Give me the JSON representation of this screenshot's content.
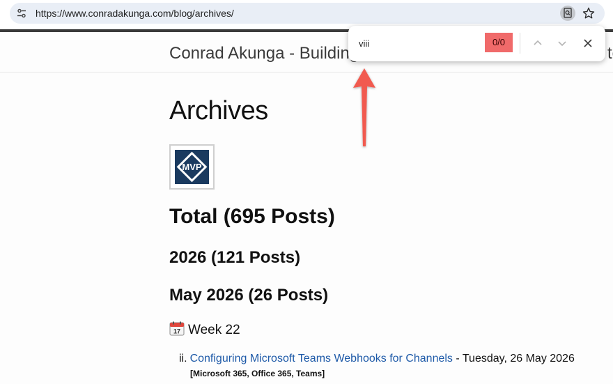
{
  "browser": {
    "url": "https://www.conradakunga.com/blog/archives/",
    "icons": {
      "site_settings": "tune-icon",
      "find": "find-in-page-icon",
      "bookmark": "star-icon"
    }
  },
  "find_bar": {
    "query": "viii",
    "match_count": "0/0",
    "no_match_color": "#f06a6a",
    "icons": {
      "previous": "chevron-up-icon",
      "next": "chevron-down-icon",
      "close": "close-icon"
    }
  },
  "site": {
    "title": "Conrad Akunga - Building",
    "title_tail": "te"
  },
  "content": {
    "page_title": "Archives",
    "badge_text": "MVP",
    "total_heading": "Total (695 Posts)",
    "year_heading": "2026 (121 Posts)",
    "month_heading": "May 2026 (26 Posts)",
    "week_heading": "Week 22",
    "week_icon": "calendar-icon",
    "posts": [
      {
        "numeral": "ii.",
        "title": "Configuring Microsoft Teams Webhooks for Channels",
        "date_text": " - Tuesday, 26 May 2026",
        "tags": "[Microsoft 365, Office 365, Teams]"
      }
    ]
  },
  "annotation": {
    "arrow_color": "#f15a50"
  }
}
